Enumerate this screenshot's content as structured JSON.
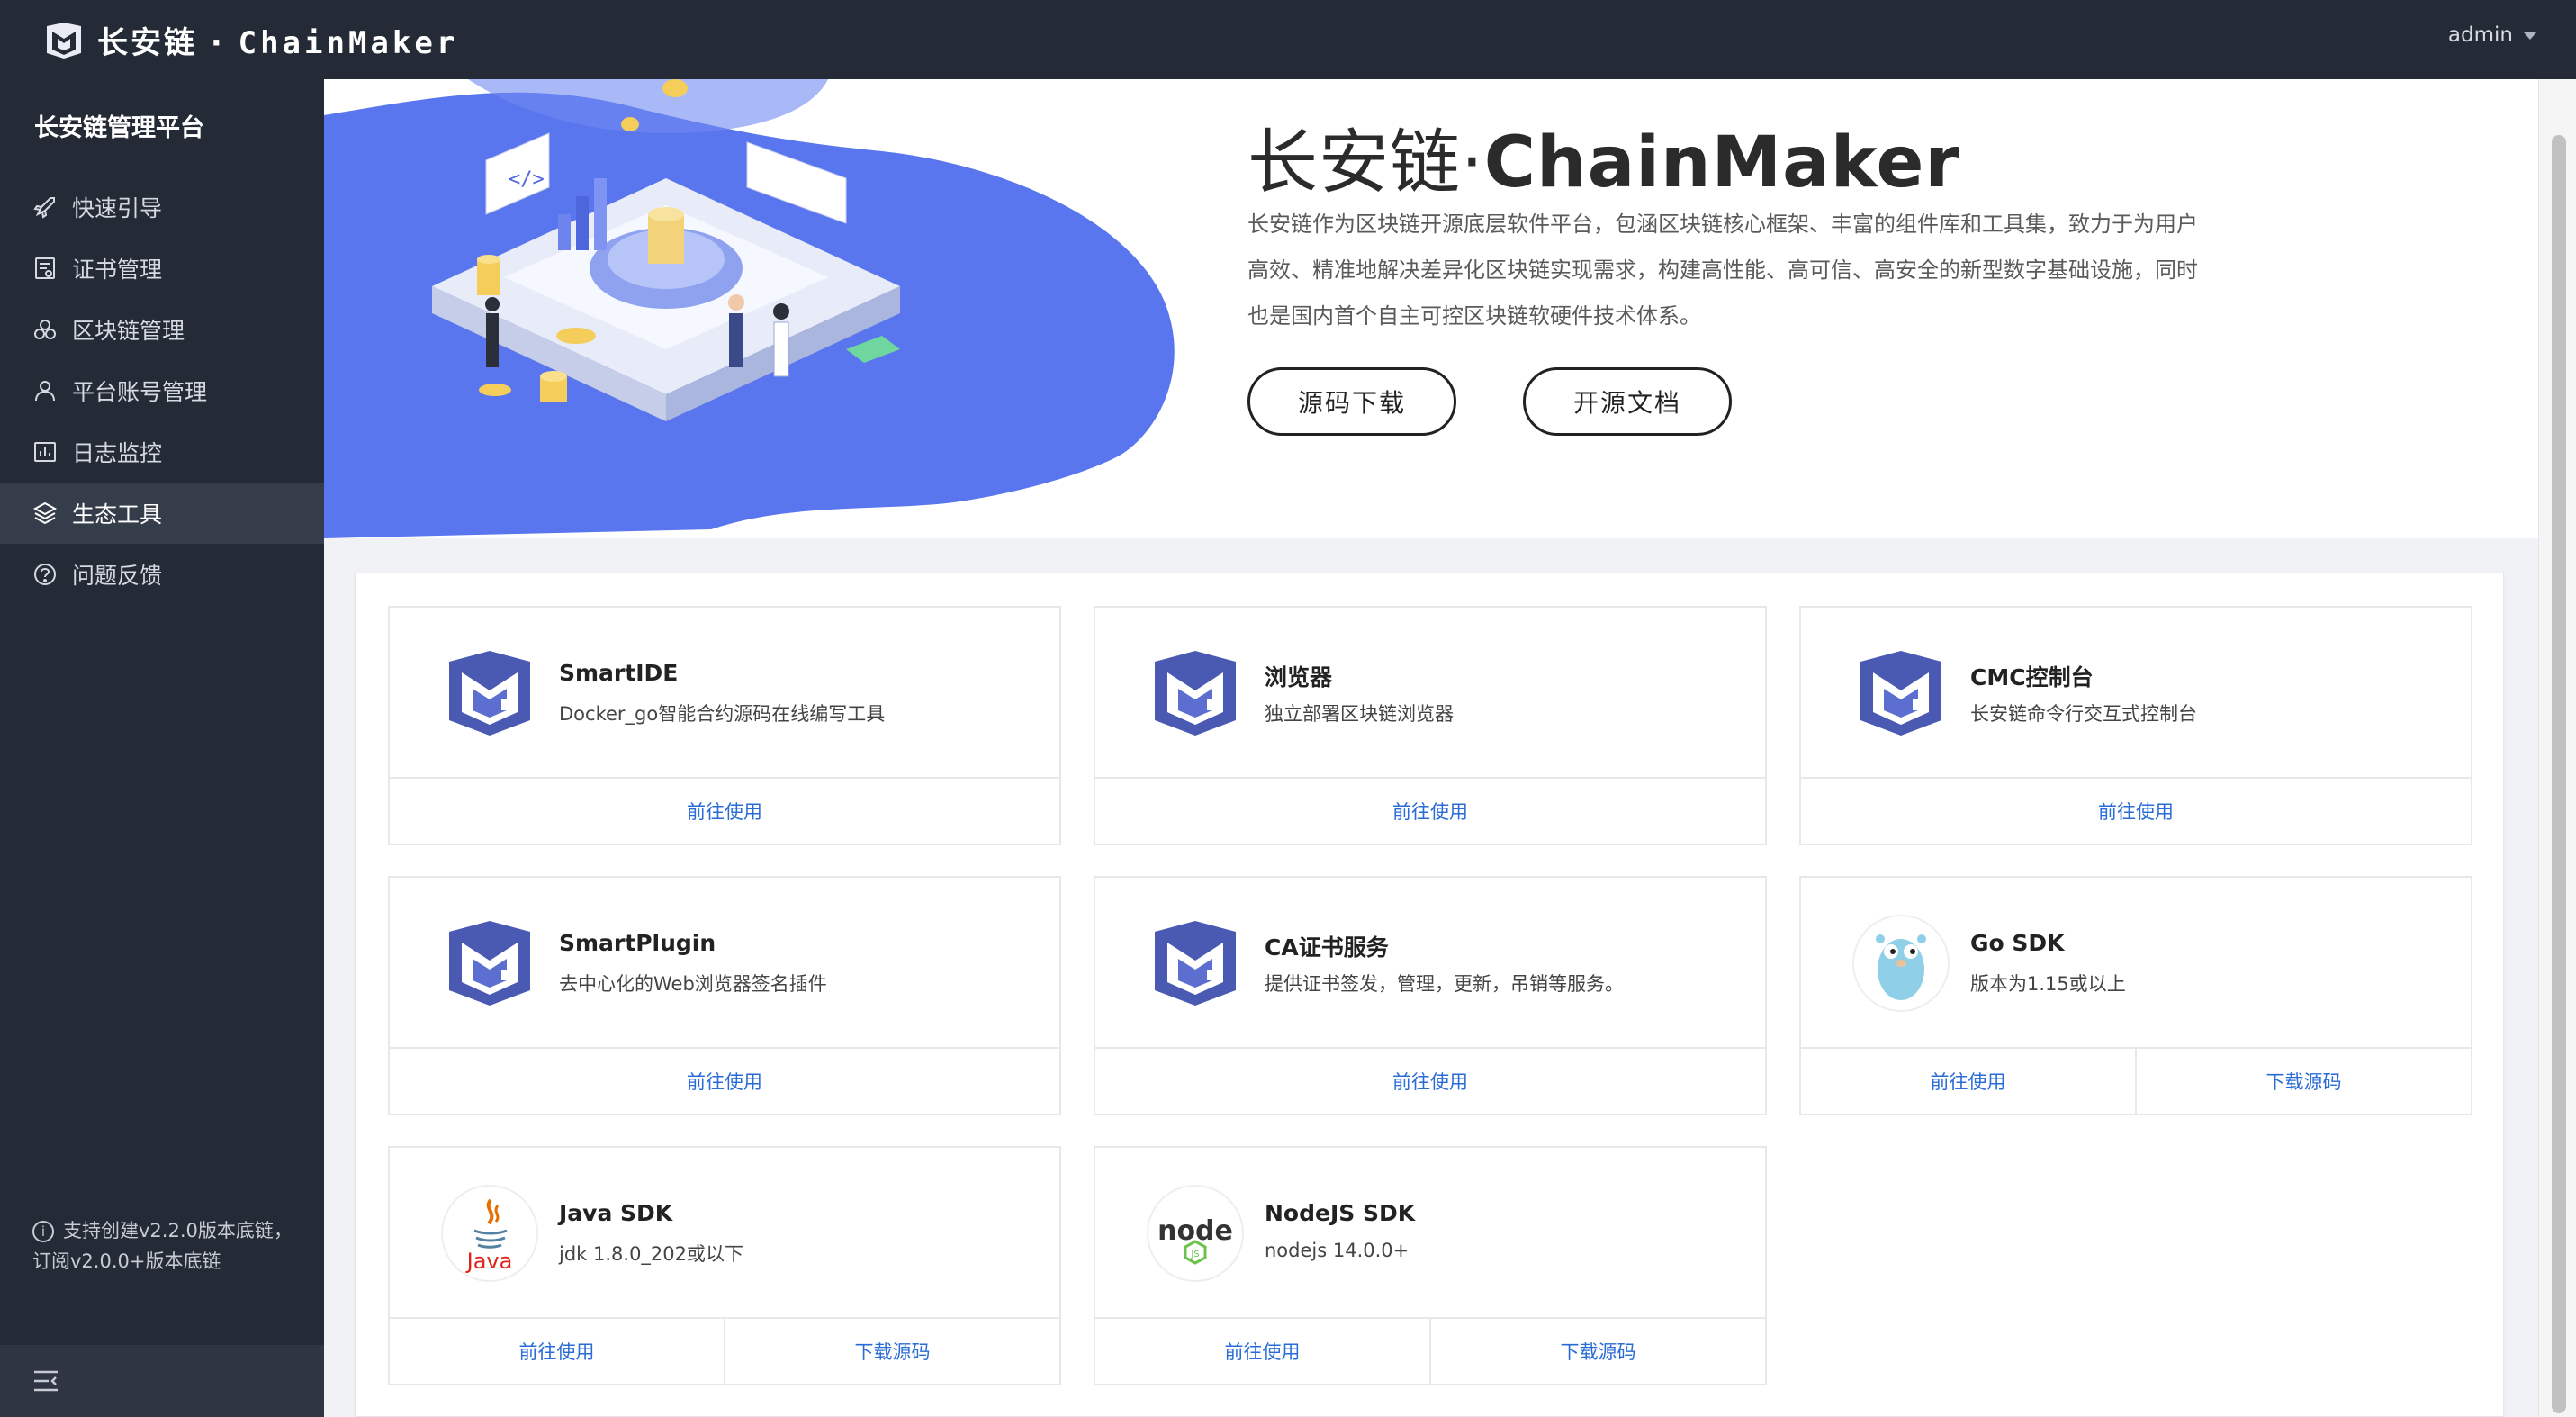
{
  "app": {
    "brand_cn": "长安链",
    "brand_sep": "·",
    "brand_en": "ChainMaker",
    "user": "admin"
  },
  "sidebar": {
    "title": "长安链管理平台",
    "items": [
      {
        "label": "快速引导",
        "icon": "rocket-icon"
      },
      {
        "label": "证书管理",
        "icon": "certificate-icon"
      },
      {
        "label": "区块链管理",
        "icon": "blockchain-icon"
      },
      {
        "label": "平台账号管理",
        "icon": "user-icon"
      },
      {
        "label": "日志监控",
        "icon": "monitor-icon"
      },
      {
        "label": "生态工具",
        "icon": "layers-icon",
        "active": true
      },
      {
        "label": "问题反馈",
        "icon": "question-icon"
      }
    ],
    "note": "支持创建v2.2.0版本底链，订阅v2.0.0+版本底链"
  },
  "hero": {
    "title_cn": "长安链·",
    "title_en": "ChainMaker",
    "description": "长安链作为区块链开源底层软件平台，包涵区块链核心框架、丰富的组件库和工具集，致力于为用户高效、精准地解决差异化区块链实现需求，构建高性能、高可信、高安全的新型数字基础设施，同时也是国内首个自主可控区块链软硬件技术体系。",
    "buttons": [
      "源码下载",
      "开源文档"
    ]
  },
  "tools": [
    {
      "name": "SmartIDE",
      "desc": "Docker_go智能合约源码在线编写工具",
      "logo": "chainmaker-logo",
      "actions": [
        "前往使用"
      ]
    },
    {
      "name": "浏览器",
      "desc": "独立部署区块链浏览器",
      "logo": "chainmaker-logo",
      "actions": [
        "前往使用"
      ]
    },
    {
      "name": "CMC控制台",
      "desc": "长安链命令行交互式控制台",
      "logo": "chainmaker-logo",
      "actions": [
        "前往使用"
      ]
    },
    {
      "name": "SmartPlugin",
      "desc": "去中心化的Web浏览器签名插件",
      "logo": "chainmaker-logo",
      "actions": [
        "前往使用"
      ]
    },
    {
      "name": "CA证书服务",
      "desc": "提供证书签发，管理，更新，吊销等服务。",
      "logo": "chainmaker-logo",
      "actions": [
        "前往使用"
      ]
    },
    {
      "name": "Go SDK",
      "desc": "版本为1.15或以上",
      "logo": "go-gopher-logo",
      "actions": [
        "前往使用",
        "下载源码"
      ]
    },
    {
      "name": "Java SDK",
      "desc": "jdk 1.8.0_202或以下",
      "logo": "java-logo",
      "actions": [
        "前往使用",
        "下载源码"
      ]
    },
    {
      "name": "NodeJS SDK",
      "desc": "nodejs 14.0.0+",
      "logo": "nodejs-logo",
      "actions": [
        "前往使用",
        "下载源码"
      ]
    }
  ],
  "logo_text": {
    "java": "Java",
    "node": "node",
    "js": "JS"
  },
  "colors": {
    "topbar": "#242a36",
    "accent_link": "#2a6cd6",
    "hero_blob": "#5a76ee"
  }
}
